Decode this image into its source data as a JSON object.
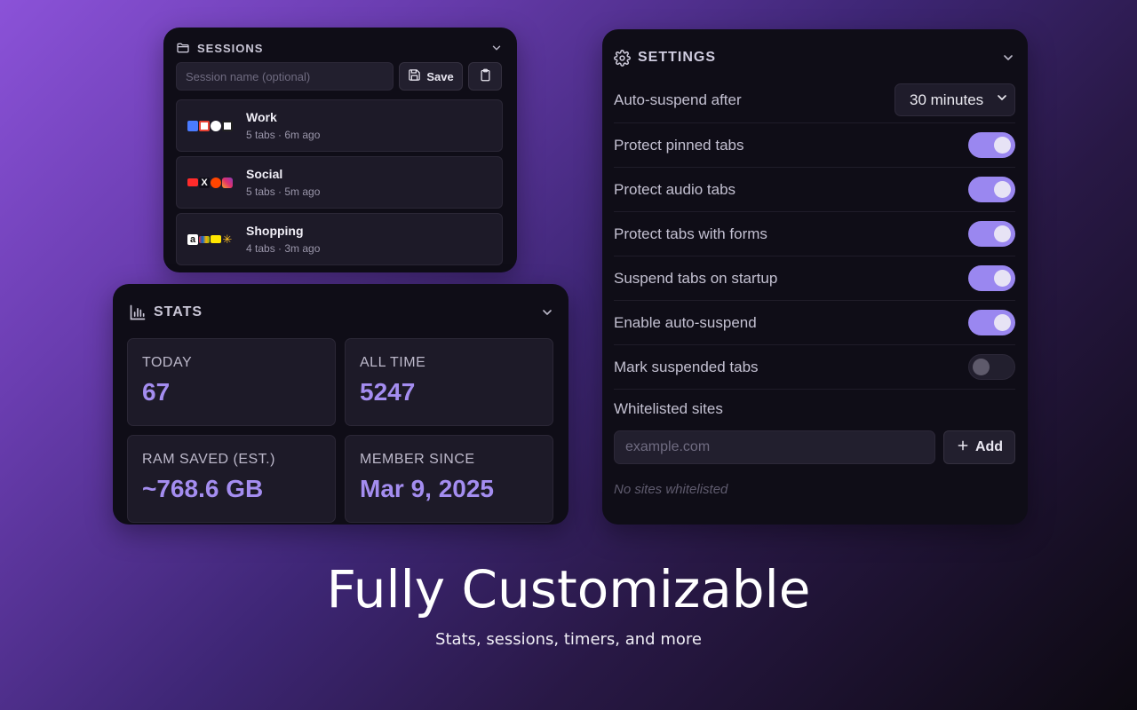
{
  "sessions": {
    "title": "SESSIONS",
    "input_placeholder": "Session name (optional)",
    "save_label": "Save",
    "items": [
      {
        "name": "Work",
        "meta": "5 tabs · 6m ago"
      },
      {
        "name": "Social",
        "meta": "5 tabs · 5m ago"
      },
      {
        "name": "Shopping",
        "meta": "4 tabs · 3m ago"
      }
    ]
  },
  "stats": {
    "title": "STATS",
    "cards": [
      {
        "label": "TODAY",
        "value": "67"
      },
      {
        "label": "ALL TIME",
        "value": "5247"
      },
      {
        "label": "RAM SAVED (EST.)",
        "value": "~768.6 GB"
      },
      {
        "label": "MEMBER SINCE",
        "value": "Mar 9, 2025"
      }
    ]
  },
  "settings": {
    "title": "SETTINGS",
    "auto_suspend_label": "Auto-suspend after",
    "auto_suspend_value": "30 minutes",
    "toggles": [
      {
        "label": "Protect pinned tabs",
        "on": true
      },
      {
        "label": "Protect audio tabs",
        "on": true
      },
      {
        "label": "Protect tabs with forms",
        "on": true
      },
      {
        "label": "Suspend tabs on startup",
        "on": true
      },
      {
        "label": "Enable auto-suspend",
        "on": true
      },
      {
        "label": "Mark suspended tabs",
        "on": false
      }
    ],
    "whitelist_title": "Whitelisted sites",
    "whitelist_placeholder": "example.com",
    "add_label": "Add",
    "whitelist_empty": "No sites whitelisted"
  },
  "headline": "Fully Customizable",
  "subline": "Stats, sessions, timers, and more",
  "colors": {
    "accent": "#a48df0",
    "toggle_on": "#9a87f0",
    "panel": "#0f0d17"
  }
}
